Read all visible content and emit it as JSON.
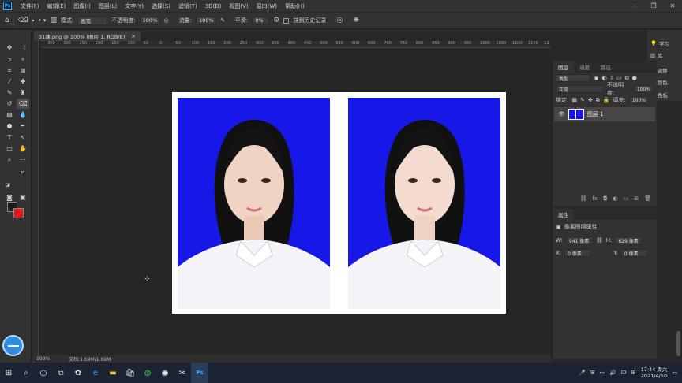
{
  "menubar": {
    "logo": "Ps",
    "items": [
      "文件(F)",
      "编辑(E)",
      "图像(I)",
      "图层(L)",
      "文字(Y)",
      "选择(S)",
      "滤镜(T)",
      "3D(D)",
      "视图(V)",
      "窗口(W)",
      "帮助(H)"
    ]
  },
  "options": {
    "mode_label": "模式:",
    "mode_value": "画笔",
    "opacity_label": "不透明度:",
    "opacity_value": "100%",
    "flow_label": "流量:",
    "flow_value": "100%",
    "smooth_label": "平滑:",
    "smooth_value": "0%",
    "erase_history_label": "抹到历史记录"
  },
  "document": {
    "tab_title": "31课.png @ 100% (图层 1, RGB/8)",
    "close_glyph": "×",
    "ruler_ticks": [
      "350",
      "300",
      "250",
      "200",
      "150",
      "100",
      "50",
      "0",
      "50",
      "100",
      "150",
      "200",
      "250",
      "300",
      "350",
      "400",
      "450",
      "500",
      "550",
      "600",
      "650",
      "700",
      "750",
      "800",
      "850",
      "900",
      "950",
      "1000",
      "1050",
      "1100",
      "1150",
      "12"
    ]
  },
  "status": {
    "zoom": "100%",
    "doc_info": "文档:1.69M/1.69M"
  },
  "right_strip": {
    "learn": "学习",
    "libraries": "库",
    "adjust": "调整",
    "color": "颜色",
    "swatches": "色板"
  },
  "layers_panel": {
    "tabs": [
      "图层",
      "通道",
      "路径"
    ],
    "filter_kind": "类型",
    "blend_mode": "正常",
    "opacity_label": "不透明度:",
    "opacity_value": "100%",
    "lock_label": "锁定:",
    "fill_label": "填充:",
    "fill_value": "100%",
    "layer_name": "图层 1"
  },
  "properties_panel": {
    "title": "属性",
    "subtitle": "像素图层属性",
    "w_label": "W:",
    "w_value": "941 像素",
    "h_label": "H:",
    "h_value": "629 像素",
    "x_label": "X:",
    "x_value": "0 像素",
    "y_label": "Y:",
    "y_value": "0 像素"
  },
  "taskbar": {
    "time": "17:44 周六",
    "date": "2021/4/10",
    "ime": "中"
  },
  "colors": {
    "photo_bg": "#1717e8",
    "foreground": "#1b1b1b",
    "background": "#e01a1a"
  }
}
